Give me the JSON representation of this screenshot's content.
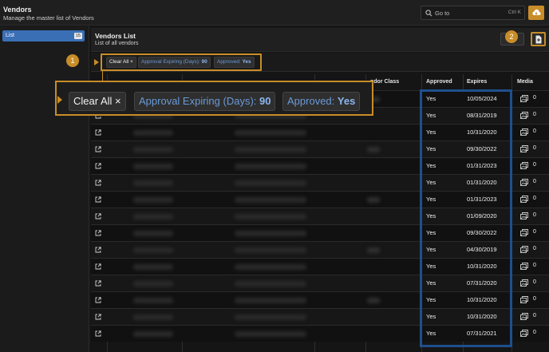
{
  "header": {
    "title": "Vendors",
    "subtitle": "Manage the master list of Vendors",
    "search_placeholder": "Go to",
    "search_shortcut": "Ctrl K"
  },
  "sidebar": {
    "items": [
      {
        "label": "List",
        "badge": "15"
      }
    ]
  },
  "panel": {
    "title": "Vendors List",
    "subtitle": "List of all vendors"
  },
  "filters": {
    "clear_label": "Clear All",
    "clear_x": "×",
    "approval_expiring_label": "Approval Expiring (Days):",
    "approval_expiring_value": "90",
    "approved_label": "Approved:",
    "approved_value": "Yes"
  },
  "callouts": [
    "1",
    "2"
  ],
  "table": {
    "columns": [
      "ndor Class",
      "Approved",
      "Expires",
      "Media"
    ],
    "rows": [
      {
        "approved": "Yes",
        "expires": "10/05/2024",
        "media": "0"
      },
      {
        "approved": "Yes",
        "expires": "08/31/2019",
        "media": "0"
      },
      {
        "approved": "Yes",
        "expires": "10/31/2020",
        "media": "0"
      },
      {
        "approved": "Yes",
        "expires": "09/30/2022",
        "media": "0"
      },
      {
        "approved": "Yes",
        "expires": "01/31/2023",
        "media": "0"
      },
      {
        "approved": "Yes",
        "expires": "01/31/2020",
        "media": "0"
      },
      {
        "approved": "Yes",
        "expires": "01/31/2023",
        "media": "0"
      },
      {
        "approved": "Yes",
        "expires": "01/09/2020",
        "media": "0"
      },
      {
        "approved": "Yes",
        "expires": "09/30/2022",
        "media": "0"
      },
      {
        "approved": "Yes",
        "expires": "04/30/2019",
        "media": "0"
      },
      {
        "approved": "Yes",
        "expires": "10/31/2020",
        "media": "0"
      },
      {
        "approved": "Yes",
        "expires": "07/31/2020",
        "media": "0"
      },
      {
        "approved": "Yes",
        "expires": "10/31/2020",
        "media": "0"
      },
      {
        "approved": "Yes",
        "expires": "10/31/2020",
        "media": "0"
      },
      {
        "approved": "Yes",
        "expires": "07/31/2021",
        "media": "0"
      }
    ]
  },
  "colors": {
    "accent": "#c88d28",
    "selected": "#3a6fb5",
    "highlight": "#1e4f8d",
    "filter_text": "#6a9ad8"
  },
  "icons": {
    "search": "search-icon",
    "cloud": "cloud-download-icon",
    "export": "file-export-icon",
    "link": "external-link-icon",
    "media": "media-icon"
  }
}
